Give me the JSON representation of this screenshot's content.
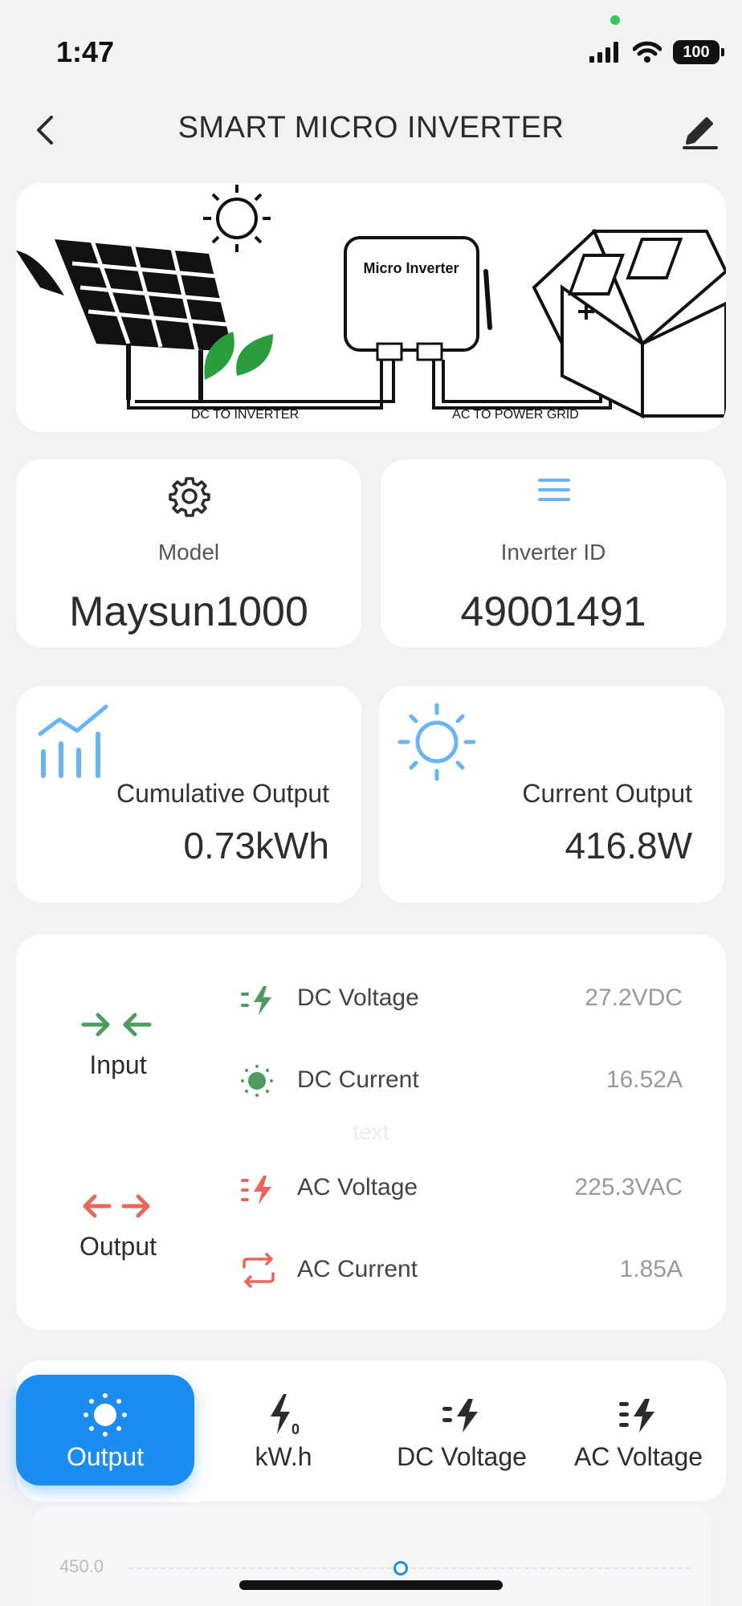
{
  "status_bar": {
    "time": "1:47",
    "battery": "100"
  },
  "header": {
    "title": "SMART MICRO INVERTER"
  },
  "hero": {
    "device_label": "Micro Inverter",
    "dc_label": "DC  TO INVERTER",
    "ac_label": "AC TO POWER GRID"
  },
  "info_cards": {
    "model": {
      "label": "Model",
      "value": "Maysun1000",
      "icon": "gear-icon"
    },
    "inverter_id": {
      "label": "Inverter ID",
      "value": "49001491",
      "icon": "menu-icon"
    }
  },
  "stats": {
    "cumulative": {
      "label": "Cumulative Output",
      "value": "0.73kWh",
      "icon": "chart-icon"
    },
    "current": {
      "label": "Current Output",
      "value": "416.8W",
      "icon": "sun-icon"
    }
  },
  "io": {
    "input_label": "Input",
    "output_label": "Output",
    "ghost_text": "text",
    "rows": [
      {
        "label": "DC Voltage",
        "value": "27.2VDC"
      },
      {
        "label": "DC Current",
        "value": "16.52A"
      },
      {
        "label": "AC Voltage",
        "value": "225.3VAC"
      },
      {
        "label": "AC Current",
        "value": "1.85A"
      }
    ],
    "colors": {
      "input": "#4f9a5e",
      "output": "#e8675a"
    }
  },
  "tabs": [
    {
      "label": "Output",
      "active": true
    },
    {
      "label": "kW.h"
    },
    {
      "label": "DC Voltage"
    },
    {
      "label": "AC Voltage"
    }
  ],
  "chart": {
    "y_tick": "450.0"
  },
  "colors": {
    "accent": "#1b8cf0",
    "light_blue": "#6ab4f2"
  }
}
